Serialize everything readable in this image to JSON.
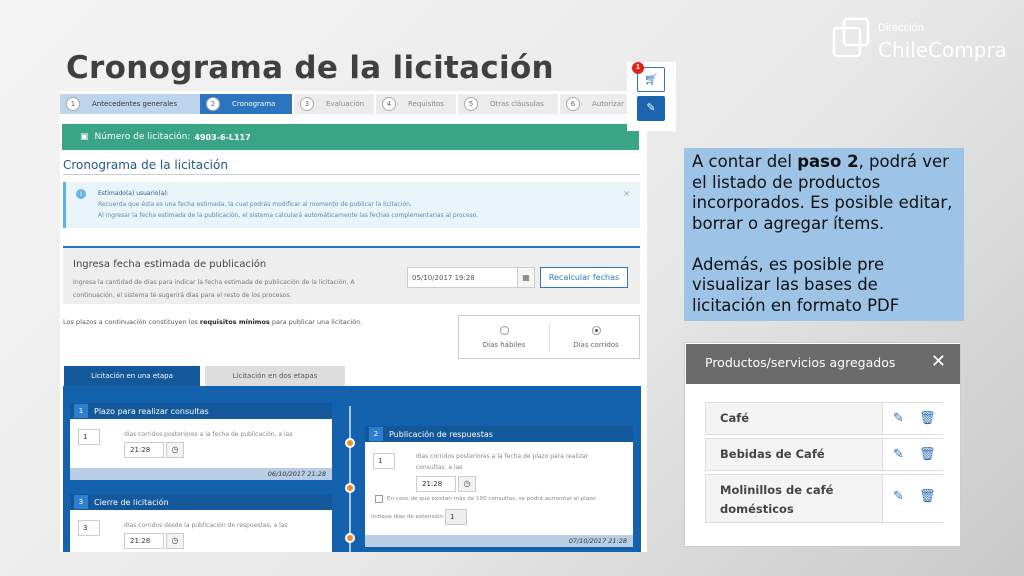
{
  "slide": {
    "title": "Cronograma de la licitación"
  },
  "logo": {
    "line1": "Dirección",
    "line2": "ChileCompra"
  },
  "steps": [
    {
      "num": "1",
      "label": "Antecedentes generales",
      "state": "done"
    },
    {
      "num": "2",
      "label": "Cronograma",
      "state": "active"
    },
    {
      "num": "3",
      "label": "Evaluación",
      "state": "todo"
    },
    {
      "num": "4",
      "label": "Requisitos",
      "state": "todo"
    },
    {
      "num": "5",
      "label": "Otras cláusulas",
      "state": "todo"
    },
    {
      "num": "6",
      "label": "Autorizar",
      "state": "todo"
    }
  ],
  "licitacion": {
    "label": "Número de licitación:",
    "number": "4903-6-L117"
  },
  "section_title": "Cronograma de la licitación",
  "info": {
    "heading": "Estimado(a) usuario(a):",
    "line1": "Recuerda que ésta es una fecha estimada, la cual podrás modificar al momento de publicar la licitación.",
    "line2": "Al ingresar la fecha estimada de la publicación, el sistema calculará automáticamente las fechas complementarias al proceso.",
    "close": "×"
  },
  "fecha": {
    "title": "Ingresa fecha estimada de publicación",
    "desc": "Ingresa la cantidad de días para indicar la fecha estimada de publicación de la licitación. A continuación, el sistema te sugerirá días para el resto de los procesos.",
    "value": "05/10/2017 19:28",
    "button": "Recalcular fechas"
  },
  "plazos": {
    "prefix": "Los plazos a continuación constituyen los ",
    "bold": "requisitos mínimos",
    "suffix": " para publicar una licitación."
  },
  "radio": {
    "opt1": "Días hábiles",
    "opt2": "Días corridos",
    "selected": "opt2"
  },
  "tabs": {
    "tab1": "Licitación en una etapa",
    "tab2": "Licitación en dos etapas"
  },
  "cards": {
    "c1": {
      "num": "1",
      "title": "Plazo para realizar consultas",
      "days": "1",
      "text": "días corridos posteriores a la fecha de publicación, a las",
      "time": "21:28",
      "date": "06/10/2017 21:28"
    },
    "c2": {
      "num": "2",
      "title": "Publicación de respuestas",
      "days": "1",
      "text1": "días corridos posteriores a la fecha de plazo para realizar",
      "text2": "consultas, a las",
      "time": "21:28",
      "check": "En caso de que existan más de 100 consultas, se podrá aumentar el plazo.",
      "ext_label": "Indique días de extensión:",
      "ext": "1",
      "date": "07/10/2017 21:28"
    },
    "c3": {
      "num": "3",
      "title": "Cierre de licitación",
      "days": "3",
      "text": "días corridos desde la publicación de respuestas, a las",
      "time": "21:28"
    }
  },
  "top_icons": {
    "badge": "1",
    "cart": "cart-icon",
    "doc": "document-icon"
  },
  "note": {
    "p1_a": "A contar del ",
    "p1_b": "paso 2",
    "p1_c": ", podrá ver el listado de productos incorporados. Es posible editar, borrar o agregar ítems.",
    "p2": "Además, es posible pre visualizar las bases de licitación en formato PDF"
  },
  "products": {
    "title": "Productos/servicios agregados",
    "close": "✕",
    "items": [
      {
        "name": "Café"
      },
      {
        "name": "Bebidas de Café"
      },
      {
        "name": "Molinillos de café domésticos"
      }
    ]
  },
  "colors": {
    "accent": "#2a75be",
    "green": "#3aa584",
    "orange": "#f08c1e",
    "note_bg": "#9dc3e6"
  }
}
